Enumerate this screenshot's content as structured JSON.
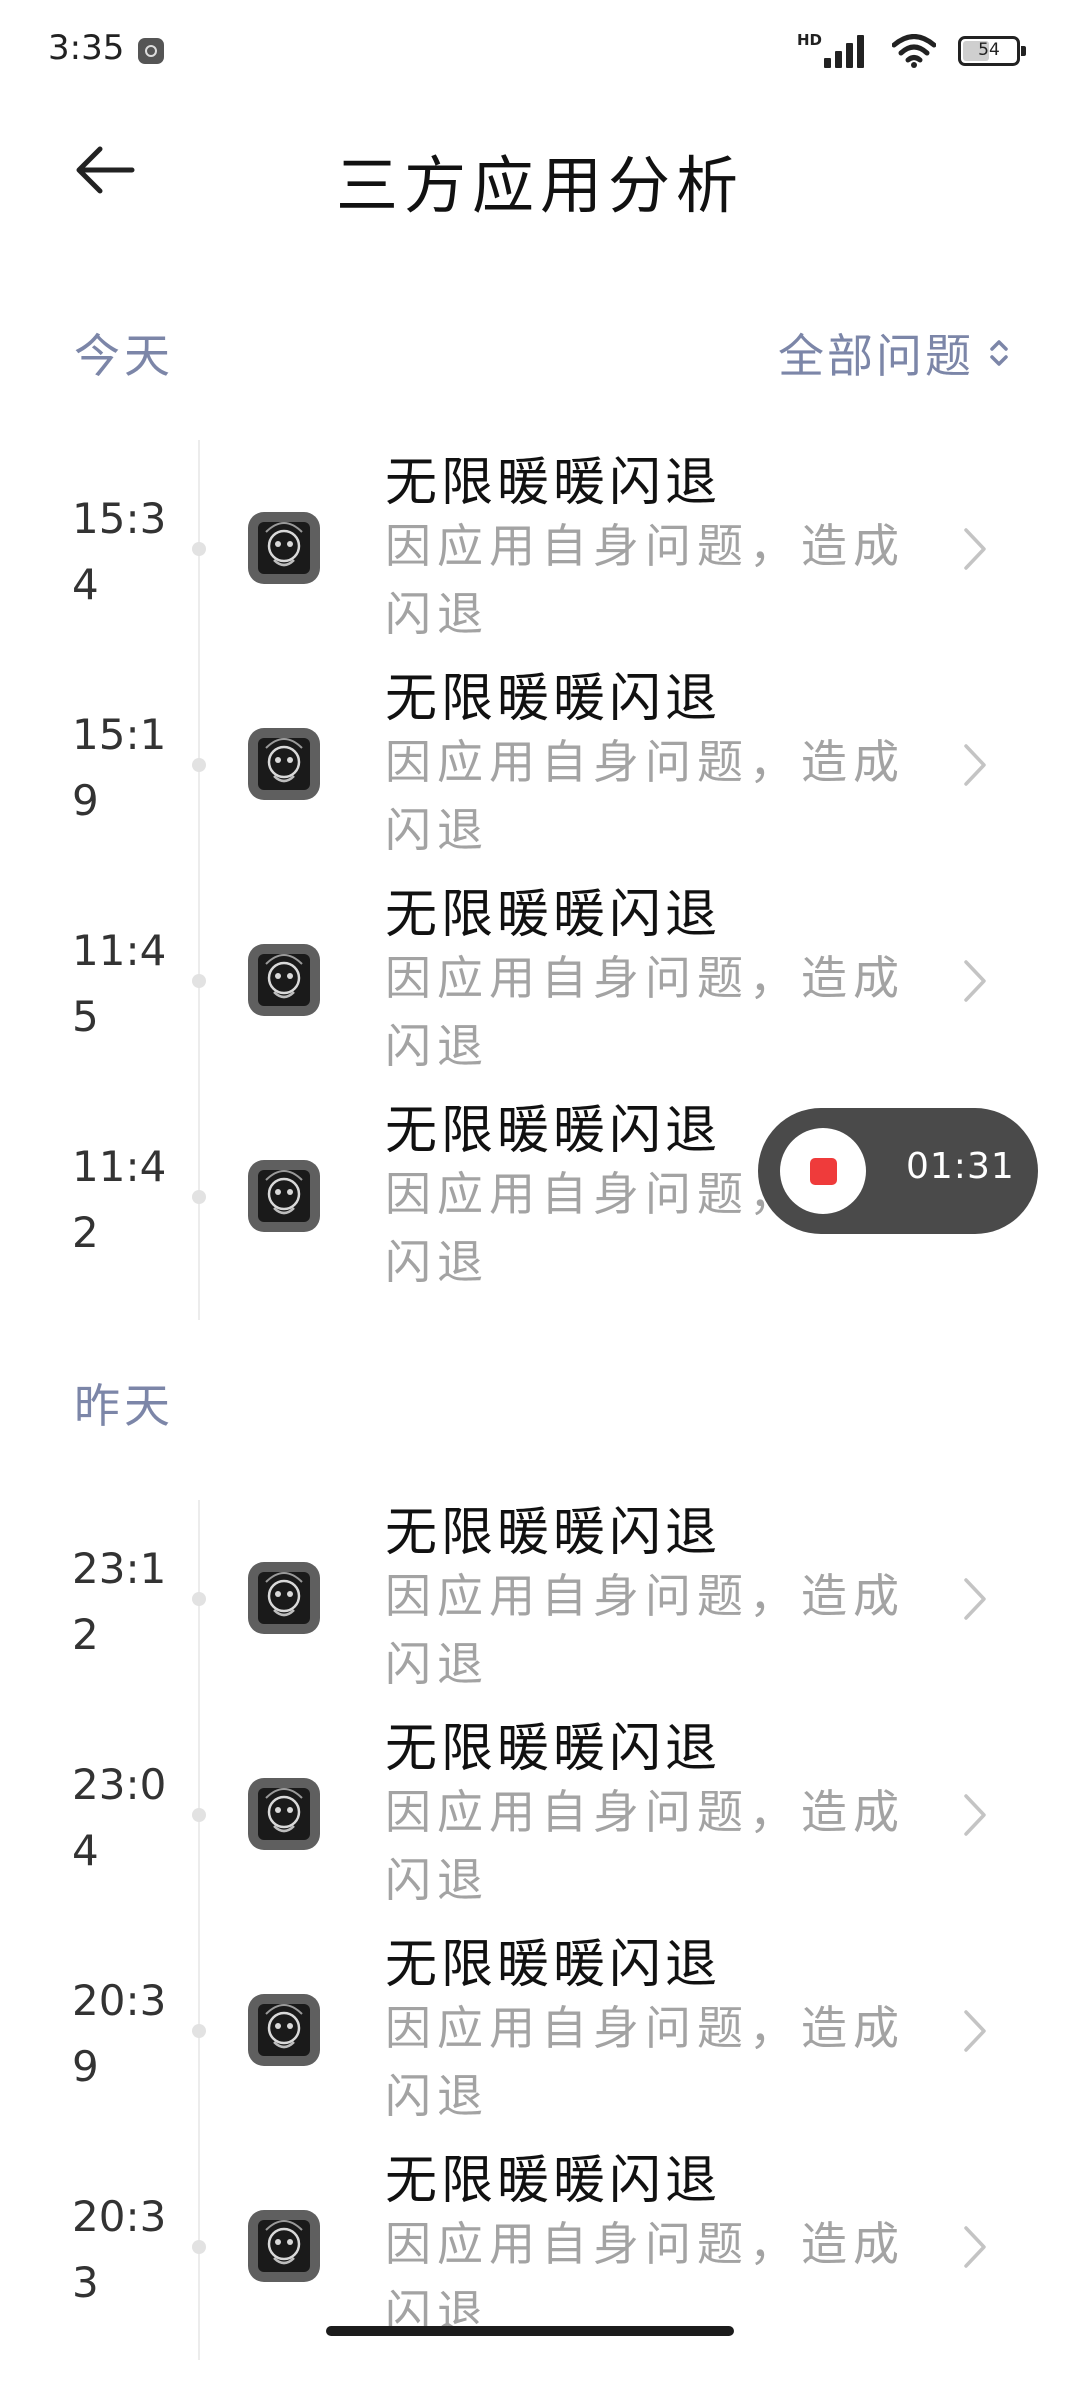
{
  "status_bar": {
    "time": "3:35",
    "network": "HD",
    "battery": "54",
    "battery_level": 0.54
  },
  "header": {
    "title": "三方应用分析"
  },
  "sections": [
    {
      "label": "今天",
      "filter_label": "全部问题",
      "items": [
        {
          "time": "15:34",
          "title": "无限暖暖闪退",
          "desc": "因应用自身问题，造成闪退"
        },
        {
          "time": "15:19",
          "title": "无限暖暖闪退",
          "desc": "因应用自身问题，造成闪退"
        },
        {
          "time": "11:45",
          "title": "无限暖暖闪退",
          "desc": "因应用自身问题，造成闪退"
        },
        {
          "time": "11:42",
          "title": "无限暖暖闪退",
          "desc": "因应用自身问题，造成闪退"
        }
      ]
    },
    {
      "label": "昨天",
      "items": [
        {
          "time": "23:12",
          "title": "无限暖暖闪退",
          "desc": "因应用自身问题，造成闪退"
        },
        {
          "time": "23:04",
          "title": "无限暖暖闪退",
          "desc": "因应用自身问题，造成闪退"
        },
        {
          "time": "20:39",
          "title": "无限暖暖闪退",
          "desc": "因应用自身问题，造成闪退"
        },
        {
          "time": "20:33",
          "title": "无限暖暖闪退",
          "desc": "因应用自身问题，造成闪退"
        }
      ]
    }
  ],
  "recorder": {
    "elapsed": "01:31",
    "accent_color": "#ef3b3b"
  },
  "icons": {
    "back": "arrow-left-icon",
    "filter": "sort-updown-icon",
    "chevron": "chevron-right-icon",
    "app": "app-icon"
  }
}
